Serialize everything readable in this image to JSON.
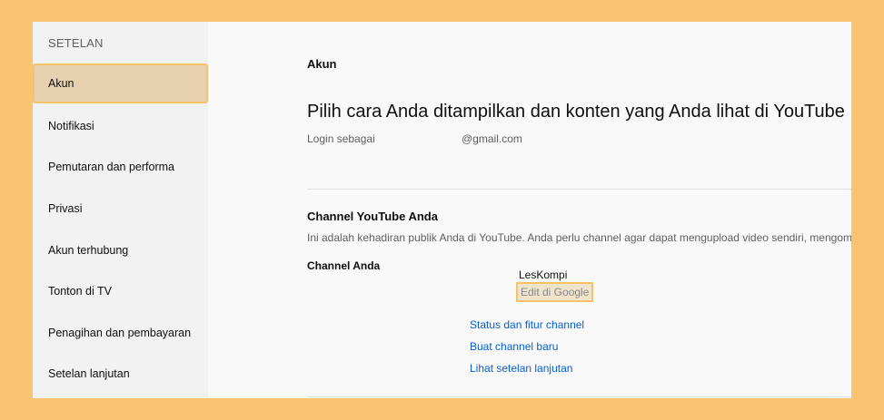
{
  "sidebar": {
    "title": "SETELAN",
    "items": [
      {
        "label": "Akun",
        "active": true
      },
      {
        "label": "Notifikasi"
      },
      {
        "label": "Pemutaran dan performa"
      },
      {
        "label": "Privasi"
      },
      {
        "label": "Akun terhubung"
      },
      {
        "label": "Tonton di TV"
      },
      {
        "label": "Penagihan dan pembayaran"
      },
      {
        "label": "Setelan lanjutan"
      }
    ]
  },
  "main": {
    "section_label": "Akun",
    "headline": "Pilih cara Anda ditampilkan dan konten yang Anda lihat di YouTube",
    "login_label": "Login sebagai",
    "login_email": "@gmail.com",
    "channel_section_title": "Channel YouTube Anda",
    "channel_description": "Ini adalah kehadiran publik Anda di YouTube. Anda perlu channel agar dapat mengupload video sendiri, mengomentari",
    "channel_label": "Channel Anda",
    "channel_name": "LesKompi",
    "edit_google_label": "Edit di Google",
    "links": {
      "status": "Status dan fitur channel",
      "new_channel": "Buat channel baru",
      "advanced": "Lihat setelan lanjutan"
    }
  },
  "colors": {
    "background": "#f8c471",
    "highlight": "#f6c16b",
    "active_item_bg": "#e8d1b0",
    "link": "#065fd4"
  }
}
